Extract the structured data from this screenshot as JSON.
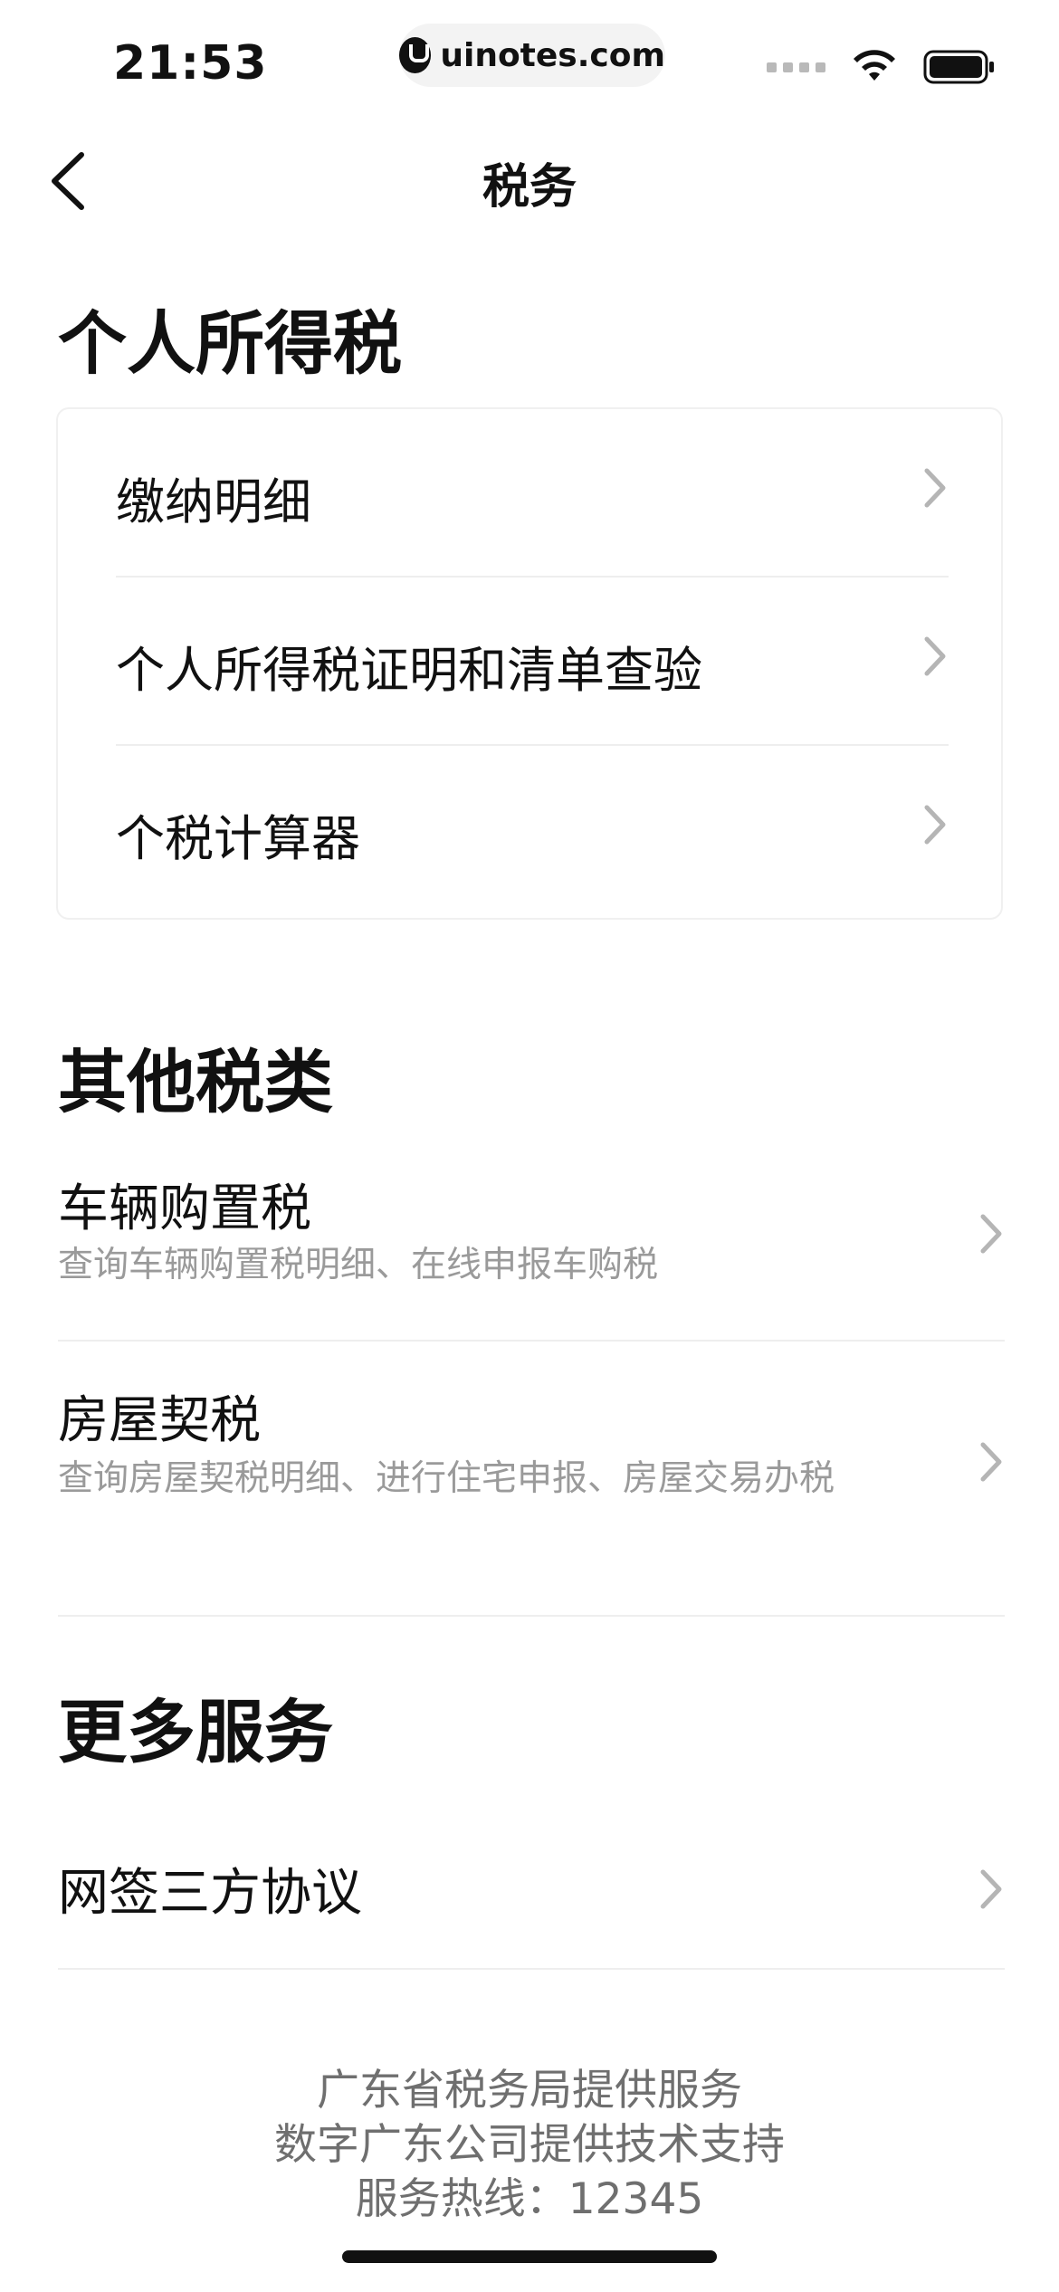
{
  "status_bar": {
    "time": "21:53",
    "site": "uinotes.com",
    "icons": [
      "cellular-signal-icon",
      "wifi-icon",
      "battery-icon"
    ]
  },
  "nav": {
    "title": "税务",
    "back_icon": "chevron-left-icon"
  },
  "sections": {
    "personal": {
      "title": "个人所得税",
      "items": [
        {
          "label": "缴纳明细"
        },
        {
          "label": "个人所得税证明和清单查验"
        },
        {
          "label": "个税计算器"
        }
      ]
    },
    "other": {
      "title": "其他税类",
      "items": [
        {
          "title": "车辆购置税",
          "desc": "查询车辆购置税明细、在线申报车购税"
        },
        {
          "title": "房屋契税",
          "desc": "查询房屋契税明细、进行住宅申报、房屋交易办税"
        }
      ]
    },
    "more": {
      "title": "更多服务",
      "items": [
        {
          "title": "网签三方协议"
        }
      ]
    }
  },
  "footer": {
    "line1": "广东省税务局提供服务",
    "line2": "数字广东公司提供技术支持",
    "line3": "服务热线：12345"
  },
  "colors": {
    "text_primary": "#111111",
    "text_secondary": "#9a9a9a",
    "footer_text": "#6f6f6f",
    "divider": "#eeeeee",
    "chevron": "#b5b5b5"
  }
}
